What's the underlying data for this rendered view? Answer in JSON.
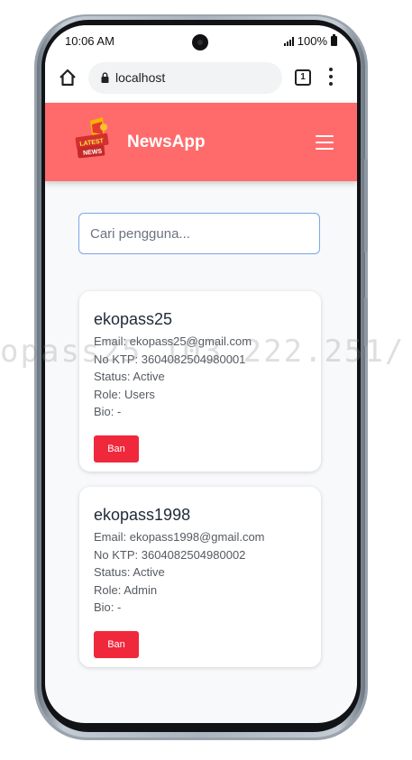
{
  "status_bar": {
    "time": "10:06 AM",
    "battery": "100%"
  },
  "browser": {
    "url": "localhost",
    "tab_count": "1"
  },
  "app": {
    "title": "NewsApp",
    "logo_text": "LATEST NEWS",
    "header_color": "#ff6b6b"
  },
  "search": {
    "placeholder": "Cari pengguna..."
  },
  "users": [
    {
      "username": "ekopass25",
      "email": "Email: ekopass25@gmail.com",
      "ktp": "No KTP: 3604082504980001",
      "status": "Status: Active",
      "role": "Role: Users",
      "bio": "Bio: -",
      "ban_label": "Ban"
    },
    {
      "username": "ekopass1998",
      "email": "Email: ekopass1998@gmail.com",
      "ktp": "No KTP: 3604082504980002",
      "status": "Status: Active",
      "role": "Role: Admin",
      "bio": "Bio: -",
      "ban_label": "Ban"
    }
  ],
  "watermark": "opass25 103.222.251/",
  "colors": {
    "ban_button": "#f0283c",
    "accent": "#ff6b6b"
  }
}
